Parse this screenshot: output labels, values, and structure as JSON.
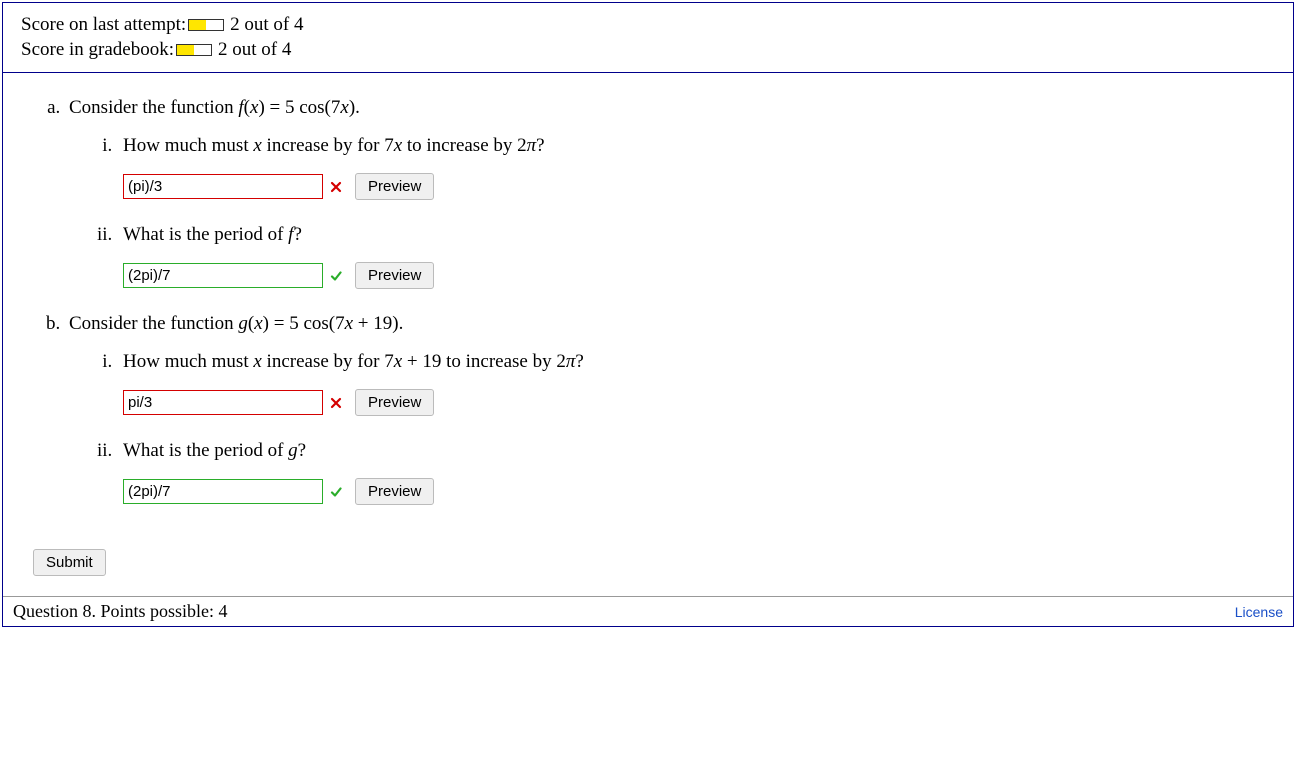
{
  "score": {
    "last_attempt_label": "Score on last attempt:",
    "last_attempt_text": "2 out of 4",
    "last_attempt_fill_pct": 50,
    "gradebook_label": "Score in gradebook:",
    "gradebook_text": "2 out of 4",
    "gradebook_fill_pct": 50
  },
  "parts": {
    "a": {
      "intro_prefix": "Consider the function ",
      "intro_func": "f(x) = 5 cos(7x)",
      "intro_suffix": ".",
      "i": {
        "prompt_prefix": "How much must ",
        "prompt_var": "x",
        "prompt_mid": " increase by for ",
        "prompt_expr": "7x",
        "prompt_mid2": " to increase by ",
        "prompt_target": "2π",
        "prompt_suffix": "?",
        "value": "(pi)/3",
        "status": "wrong"
      },
      "ii": {
        "prompt_prefix": "What is the period of ",
        "prompt_var": "f",
        "prompt_suffix": "?",
        "value": "(2pi)/7",
        "status": "correct"
      }
    },
    "b": {
      "intro_prefix": "Consider the function ",
      "intro_func": "g(x) = 5 cos(7x + 19)",
      "intro_suffix": ".",
      "i": {
        "prompt_prefix": "How much must ",
        "prompt_var": "x",
        "prompt_mid": " increase by for ",
        "prompt_expr": "7x + 19",
        "prompt_mid2": " to increase by ",
        "prompt_target": "2π",
        "prompt_suffix": "?",
        "value": "pi/3",
        "status": "wrong"
      },
      "ii": {
        "prompt_prefix": "What is the period of ",
        "prompt_var": "g",
        "prompt_suffix": "?",
        "value": "(2pi)/7",
        "status": "correct"
      }
    }
  },
  "buttons": {
    "preview": "Preview",
    "submit": "Submit"
  },
  "footer": {
    "text": "Question 8. Points possible: 4",
    "license": "License"
  }
}
